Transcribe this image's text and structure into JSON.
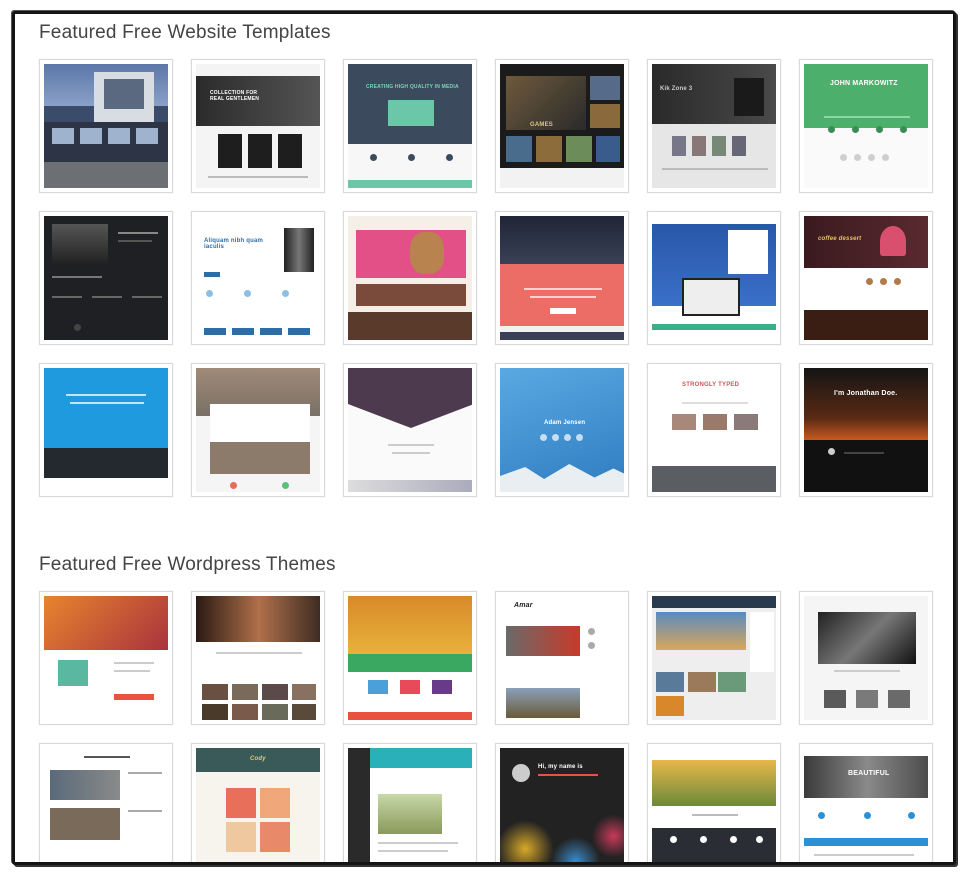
{
  "sections": {
    "templates_title": "Featured Free Website Templates",
    "wordpress_title": "Featured Free Wordpress Themes"
  },
  "templates": [
    {
      "name": "template-architecture"
    },
    {
      "name": "template-real-gentlemen",
      "text": "COLLECTION FOR REAL GENTLEMEN"
    },
    {
      "name": "template-creating-media",
      "text": "CREATING HIGH QUALITY IN MEDIA"
    },
    {
      "name": "template-games",
      "text": "GAMES"
    },
    {
      "name": "template-game-store",
      "text": "Kik Zone 3"
    },
    {
      "name": "template-john-markowitz",
      "text": "JOHN MARKOWITZ"
    },
    {
      "name": "template-business-team"
    },
    {
      "name": "template-hosting",
      "text": "Aliquam nibh quam iaculis"
    },
    {
      "name": "template-kids-toys"
    },
    {
      "name": "template-coral-landing"
    },
    {
      "name": "template-blue-landing"
    },
    {
      "name": "template-cupcake",
      "text": "coffee dessert"
    },
    {
      "name": "template-blue-business"
    },
    {
      "name": "template-city-laptop"
    },
    {
      "name": "template-purple-chevron"
    },
    {
      "name": "template-adam-jensen",
      "text": "Adam Jensen"
    },
    {
      "name": "template-strongly-typed",
      "text": "STRONGLY TYPED"
    },
    {
      "name": "template-jonathan-doe",
      "text": "I'm Jonathan Doe."
    }
  ],
  "themes": [
    {
      "name": "theme-orange-blog"
    },
    {
      "name": "theme-fashion-magazine"
    },
    {
      "name": "theme-tiger-colorful"
    },
    {
      "name": "theme-amar-blog",
      "text": "Amar"
    },
    {
      "name": "theme-travel-blog"
    },
    {
      "name": "theme-minimal-portfolio"
    },
    {
      "name": "theme-paper-news"
    },
    {
      "name": "theme-coral-portfolio",
      "text": "Cody"
    },
    {
      "name": "theme-teal-sidebar"
    },
    {
      "name": "theme-bokeh-personal",
      "text": "Hi, my name is"
    },
    {
      "name": "theme-landscape"
    },
    {
      "name": "theme-interior",
      "text": "BEAUTIFUL"
    }
  ]
}
